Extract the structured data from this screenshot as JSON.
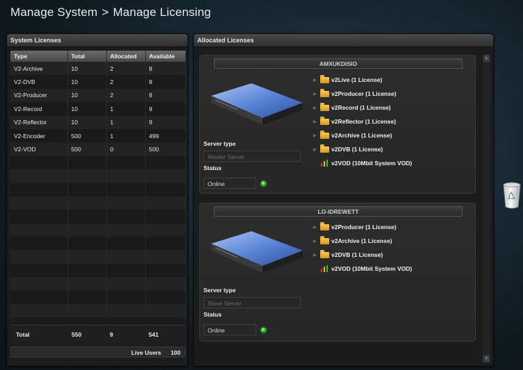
{
  "breadcrumb": {
    "root": "Manage System",
    "separator": ">",
    "current": "Manage Licensing"
  },
  "system_licenses": {
    "title": "System Licenses",
    "columns": [
      "Type",
      "Total",
      "Allocated",
      "Available"
    ],
    "rows": [
      [
        "V2-Archive",
        "10",
        "2",
        "8"
      ],
      [
        "V2-DVB",
        "10",
        "2",
        "8"
      ],
      [
        "V2-Producer",
        "10",
        "2",
        "8"
      ],
      [
        "V2-Record",
        "10",
        "1",
        "9"
      ],
      [
        "V2-Reflector",
        "10",
        "1",
        "9"
      ],
      [
        "V2-Encoder",
        "500",
        "1",
        "499"
      ],
      [
        "V2-VOD",
        "500",
        "0",
        "500"
      ]
    ],
    "total": {
      "label": "Total",
      "total": "550",
      "allocated": "9",
      "available": "541"
    },
    "live_users": {
      "label": "Live Users",
      "value": "100"
    }
  },
  "allocated_licenses": {
    "title": "Allocated Licenses",
    "servers": [
      {
        "name": "AMXUKDISIO",
        "server_type_label": "Server type",
        "server_type_value": "Master Server",
        "status_label": "Status",
        "status_value": "Online",
        "licenses": [
          "v2Live (1 License)",
          "v2Producer (1 License)",
          "v2Record (1 License)",
          "v2Reflector (1 License)",
          "v2Archive (1 License)",
          "v2DVB (1 License)",
          "v2VOD (10Mbit System VOD)"
        ]
      },
      {
        "name": "LO-IDREWETT",
        "server_type_label": "Server type",
        "server_type_value": "Slave Server",
        "status_label": "Status",
        "status_value": "Online",
        "licenses": [
          "v2Producer (1 License)",
          "v2Archive (1 License)",
          "v2DVB (1 License)",
          "v2VOD (10Mbit System VOD)"
        ]
      }
    ]
  },
  "icons": {
    "license_folder": "folder-icon",
    "vod_license": "bar-chart-icon",
    "online": "status-online-icon",
    "trash": "recycle-bin-icon"
  },
  "colors": {
    "online": "#27c21a",
    "folder": "#f0b93a"
  }
}
